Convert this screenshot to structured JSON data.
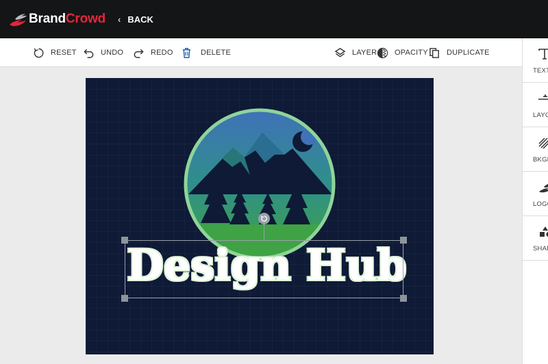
{
  "brand": {
    "name_part1": "Brand",
    "name_part2": "Crowd",
    "accent_color": "#e8243a"
  },
  "header": {
    "back_label": "BACK"
  },
  "toolbar": {
    "reset": "RESET",
    "undo": "UNDO",
    "redo": "REDO",
    "delete": "DELETE",
    "layer": "LAYER",
    "opacity": "OPACITY",
    "duplicate": "DUPLICATE"
  },
  "right_panel": {
    "items": [
      {
        "label": "TEXT",
        "icon": "text-icon"
      },
      {
        "label": "LAYOUT",
        "icon": "layout-icon"
      },
      {
        "label": "BKGROUND",
        "icon": "background-icon"
      },
      {
        "label": "LOGO",
        "icon": "logo-icon"
      },
      {
        "label": "SHAPES",
        "icon": "shapes-icon"
      }
    ]
  },
  "design": {
    "text": "Design Hub",
    "background_color": "#0e1a36",
    "ring_color": "#8fd49a",
    "gradient_top": "#3f72b8",
    "gradient_bottom": "#3fa244"
  }
}
